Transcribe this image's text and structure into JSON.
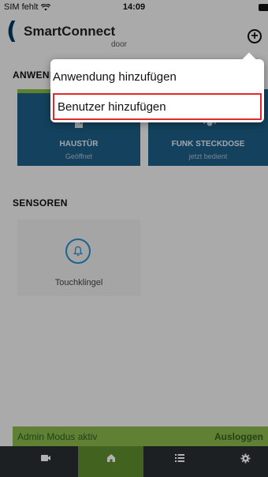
{
  "status": {
    "carrier": "SIM fehlt",
    "time": "14:09"
  },
  "header": {
    "brand_paren": "(",
    "brand_name": "SmartConnect",
    "brand_sub": "door",
    "add_symbol": "+"
  },
  "sections": {
    "applications_title": "ANWENDUNGEN",
    "sensors_title": "SENSOREN"
  },
  "tiles": [
    {
      "name": "HAUSTÜR",
      "state": "Geöffnet",
      "icon": "door-icon"
    },
    {
      "name": "FUNK STECKDOSE",
      "state": "jetzt bedient",
      "icon": "light-icon"
    }
  ],
  "sensor": {
    "label": "Touchklingel",
    "icon": "bell-icon"
  },
  "menu": {
    "items": [
      "Anwendung hinzufügen",
      "Benutzer hinzufügen"
    ],
    "highlighted_index": 1
  },
  "admin": {
    "status": "Admin Modus aktiv",
    "logout": "Ausloggen"
  },
  "tabbar": {
    "active_index": 1,
    "icons": [
      "camera-icon",
      "home-icon",
      "list-icon",
      "gear-icon"
    ]
  },
  "colors": {
    "tile_blue": "#1d5e86",
    "accent_green": "#8ab84a",
    "highlight_red": "#e02a2a",
    "sensor_blue": "#2c8fcc"
  }
}
